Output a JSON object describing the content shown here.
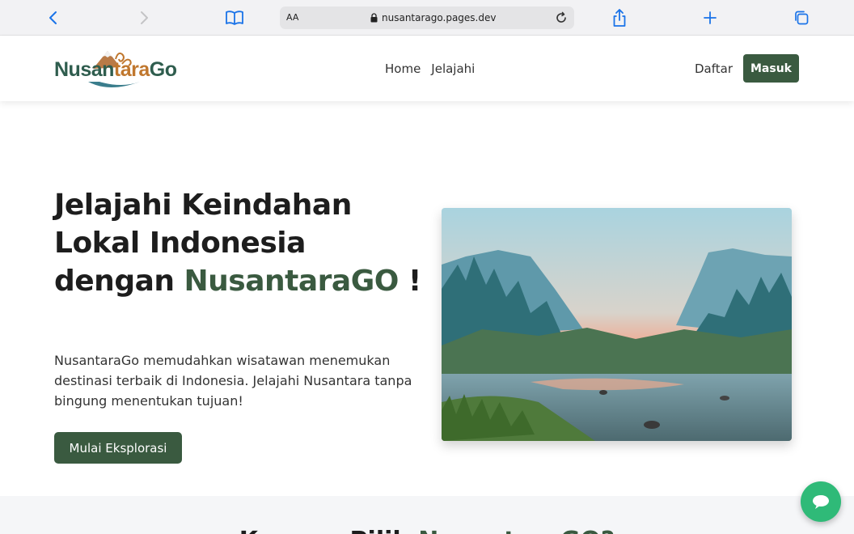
{
  "browser": {
    "reader_label": "AA",
    "url": "nusantarago.pages.dev"
  },
  "header": {
    "logo_text_1": "Nusan",
    "logo_text_2": "tara",
    "logo_text_3": "Go",
    "nav": [
      {
        "label": "Home"
      },
      {
        "label": "Jelajahi"
      }
    ],
    "register_label": "Daftar",
    "login_label": "Masuk"
  },
  "hero": {
    "title_1": "Jelajahi Keindahan Lokal Indonesia dengan ",
    "title_brand": "NusantaraGO",
    "title_end": " !",
    "description": "NusantaraGo memudahkan wisatawan menemukan destinasi terbaik di Indonesia. Jelajahi Nusantara tanpa bingung menentukan tujuan!",
    "cta_label": "Mulai Eksplorasi"
  },
  "section": {
    "title_1": "Kenapa Pilih ",
    "title_brand": "NusantaraGO?"
  },
  "colors": {
    "brand_green": "#3a5a40",
    "chat_green": "#2fba78",
    "safari_blue": "#1a73e8"
  },
  "icons": [
    "chevron-left-icon",
    "chevron-right-icon",
    "book-icon",
    "lock-icon",
    "reload-icon",
    "share-icon",
    "plus-icon",
    "tabs-icon",
    "chat-icon"
  ]
}
